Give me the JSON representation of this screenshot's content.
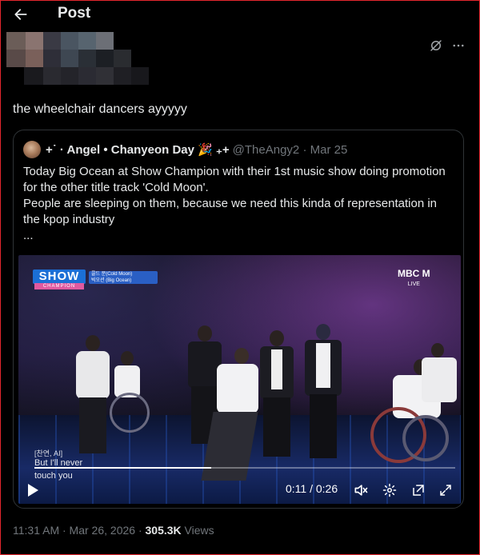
{
  "header": {
    "title": "Post"
  },
  "post": {
    "text": "the wheelchair dancers ayyyyy"
  },
  "quote": {
    "name": "+˙ · Angel • Chanyeon Day 🎉 ₊+",
    "handle_date": "@TheAngy2 · Mar 25",
    "lines": [
      "Today Big Ocean at Show Champion with their 1st music show doing promotion for the other title track 'Cold Moon'.",
      "People are sleeping on them, because we need this kinda of representation in the kpop industry",
      "..."
    ]
  },
  "video": {
    "show_logo": "SHOW",
    "show_sub": "CHAMPION",
    "song_line1": "콜드 문(Cold Moon)",
    "song_line2": "빅오션 (Big Ocean)",
    "broadcaster": "MBC M",
    "live_label": "LIVE",
    "subtitle_small": "[찬연, AI]",
    "subtitle_line1": "But I'll never",
    "subtitle_line2": "touch you",
    "time": "0:11 / 0:26",
    "progress": 0.42
  },
  "meta": {
    "time_date": "11:31 AM · Mar 26, 2026 · ",
    "views_count": "305.3K",
    "views_label": " Views"
  },
  "icons": {
    "back": "arrow-left-icon",
    "grok": "grok-icon",
    "more": "more-icon",
    "play": "play-icon",
    "mute": "volume-muted-icon",
    "settings": "gear-icon",
    "popout": "pop-out-icon",
    "fullscreen": "fullscreen-icon"
  }
}
